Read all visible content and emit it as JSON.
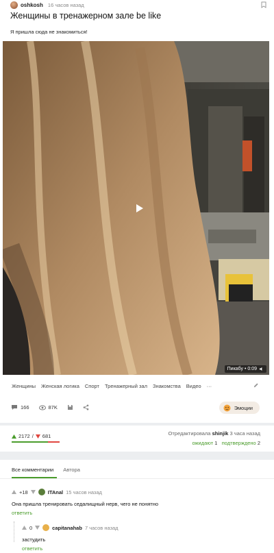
{
  "post": {
    "author": "oshkosh",
    "time": "16 часов назад",
    "title": "Женщины в тренажерном зале be like",
    "subtitle": "Я пришла сюда не знакомиться!"
  },
  "video": {
    "badge": "Пикабу • 0:09"
  },
  "tags": [
    "Женщины",
    "Женская логика",
    "Спорт",
    "Тренажерный зал",
    "Знакомства",
    "Видео",
    "···"
  ],
  "stats": {
    "comments": "166",
    "views": "87K",
    "emotions_label": "Эмоции"
  },
  "rating": {
    "up": "2172",
    "separator": "/",
    "down": "681",
    "up_fraction": 0.76,
    "up_color": "#4a9c2b",
    "down_color": "#e0463f"
  },
  "edited": {
    "prefix": "Отредактировала",
    "user": "shinjik",
    "time": "3 часа назад",
    "pending_label": "ожидают",
    "pending_count": "1",
    "confirmed_label": "подтверждено",
    "confirmed_count": "2"
  },
  "comment_tabs": {
    "all": "Все комментарии",
    "author": "Автора"
  },
  "comments": [
    {
      "rating": "+18",
      "author": "ITAnal",
      "time": "15 часов назад",
      "text": "Она пришла тренировать седалищный нерв, чего не понятно",
      "reply": "ответить"
    },
    {
      "rating": "0",
      "author": "capitanahab",
      "time": "7 часов назад",
      "text": "застудить",
      "reply": "ответить"
    }
  ],
  "colors": {
    "accent": "#4a9c2b",
    "downvote": "#e0463f"
  }
}
